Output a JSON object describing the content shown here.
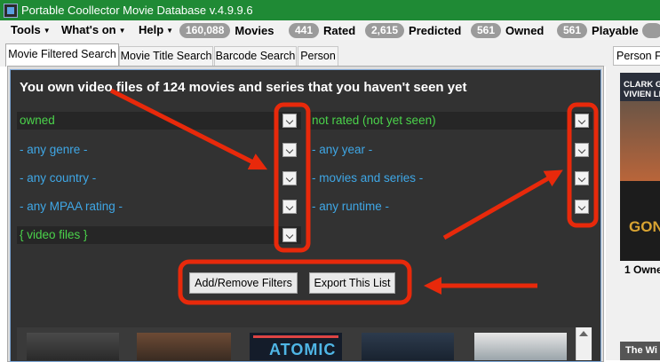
{
  "window": {
    "title": "Portable Coollector Movie Database  v.4.9.9.6"
  },
  "menubar": {
    "menus": [
      {
        "label": "Tools"
      },
      {
        "label": "What's on"
      },
      {
        "label": "Help"
      }
    ],
    "stats": [
      {
        "count": "160,088",
        "label": "Movies"
      },
      {
        "count": "441",
        "label": "Rated"
      },
      {
        "count": "2,615",
        "label": "Predicted"
      },
      {
        "count": "561",
        "label": "Owned"
      },
      {
        "count": "561",
        "label": "Playable"
      }
    ]
  },
  "tabs": [
    {
      "label": "Movie Filtered Search",
      "active": true
    },
    {
      "label": "Movie Title Search"
    },
    {
      "label": "Barcode Search"
    },
    {
      "label": "Person"
    }
  ],
  "right_panel": {
    "tab_label": "Person Filt",
    "poster_names": [
      "CLARK GA",
      "VIVIEN LE"
    ],
    "poster_title": "GON",
    "count_text": "1  Owne",
    "bottom_text": "The Wi"
  },
  "main": {
    "headline": "You own video files of 124 movies and series that you haven't seen yet",
    "filters_left": [
      {
        "text": "owned",
        "color": "green"
      },
      {
        "text": "- any genre -",
        "color": "blue"
      },
      {
        "text": "- any country -",
        "color": "blue"
      },
      {
        "text": "- any MPAA rating -",
        "color": "blue"
      },
      {
        "text": "{ video files }",
        "color": "green"
      }
    ],
    "filters_right": [
      {
        "text": "not rated (not yet seen)",
        "color": "green"
      },
      {
        "text": "- any year -",
        "color": "blue"
      },
      {
        "text": "- movies and series -",
        "color": "blue"
      },
      {
        "text": "- any runtime -",
        "color": "blue"
      }
    ],
    "buttons": {
      "add_remove": "Add/Remove Filters",
      "export": "Export This List"
    },
    "thumbnails": [
      {
        "caption": ""
      },
      {
        "caption": ""
      },
      {
        "caption": "ATOMIC"
      },
      {
        "caption": ""
      },
      {
        "caption": ""
      }
    ]
  },
  "colors": {
    "titlebar": "#1f8a35",
    "annotation": "#e8290b",
    "filter_green": "#4bd34b",
    "filter_blue": "#3fa7e6"
  }
}
